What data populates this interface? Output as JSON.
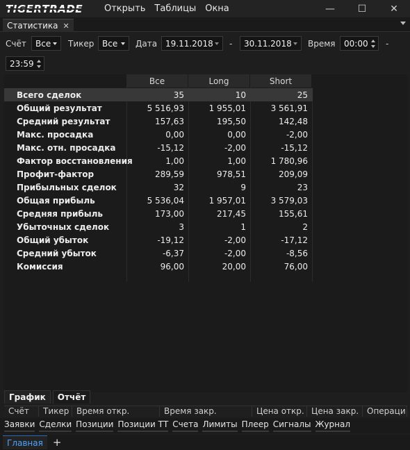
{
  "app": {
    "logo_primary": "TIGER",
    "logo_secondary": "TRADE",
    "menu": [
      "Открыть",
      "Таблицы",
      "Окна"
    ],
    "window_controls": {
      "minimize": "—",
      "maximize": "☐",
      "close": "✕"
    }
  },
  "tab": {
    "label": "Статистика",
    "close": "✕"
  },
  "filters": {
    "account_label": "Счёт",
    "account_value": "Все",
    "ticker_label": "Тикер",
    "ticker_value": "Все",
    "date_label": "Дата",
    "date_from": "19.11.2018",
    "date_separator": "-",
    "date_to": "30.11.2018",
    "time_label": "Время",
    "time_from": "00:00",
    "time_separator": "-",
    "time_to": "23:59"
  },
  "stats": {
    "columns": [
      "Все",
      "Long",
      "Short"
    ],
    "rows": [
      {
        "label": "Всего сделок",
        "values": [
          "35",
          "10",
          "25"
        ]
      },
      {
        "label": "Общий результат",
        "values": [
          "5 516,93",
          "1 955,01",
          "3 561,91"
        ]
      },
      {
        "label": "Средний результат",
        "values": [
          "157,63",
          "195,50",
          "142,48"
        ]
      },
      {
        "label": "Макс. просадка",
        "values": [
          "0,00",
          "0,00",
          "-2,00"
        ]
      },
      {
        "label": "Макс. отн. просадка",
        "values": [
          "-15,12",
          "-2,00",
          "-15,12"
        ]
      },
      {
        "label": "Фактор восстановления",
        "values": [
          "1,00",
          "1,00",
          "1 780,96"
        ]
      },
      {
        "label": "Профит-фактор",
        "values": [
          "289,59",
          "978,51",
          "209,09"
        ]
      },
      {
        "label": "Прибыльных сделок",
        "values": [
          "32",
          "9",
          "23"
        ]
      },
      {
        "label": "Общая прибыль",
        "values": [
          "5 536,04",
          "1 957,01",
          "3 579,03"
        ]
      },
      {
        "label": "Средняя прибыль",
        "values": [
          "173,00",
          "217,45",
          "155,61"
        ]
      },
      {
        "label": "Убыточных сделок",
        "values": [
          "3",
          "1",
          "2"
        ]
      },
      {
        "label": "Общий убыток",
        "values": [
          "-19,12",
          "-2,00",
          "-17,12"
        ]
      },
      {
        "label": "Средний убыток",
        "values": [
          "-6,37",
          "-2,00",
          "-8,56"
        ]
      },
      {
        "label": "Комиссия",
        "values": [
          "96,00",
          "20,00",
          "76,00"
        ]
      }
    ]
  },
  "bottom_tabs": [
    "График",
    "Отчёт"
  ],
  "trade_columns": [
    "Счёт",
    "Тикер",
    "Время откр.",
    "Время закр.",
    "Цена откр.",
    "Цена закр.",
    "Операци"
  ],
  "workspace_tabs": [
    "Заявки",
    "Сделки",
    "Позиции",
    "Позиции ТТ",
    "Счета",
    "Лимиты",
    "Плеер",
    "Сигналы",
    "Журнал"
  ],
  "home_tab": "Главная",
  "add_tab": "+",
  "colors": {
    "accent_blue": "#4ea3ff",
    "background": "#1e1e1e",
    "selected_row": "#383838"
  }
}
